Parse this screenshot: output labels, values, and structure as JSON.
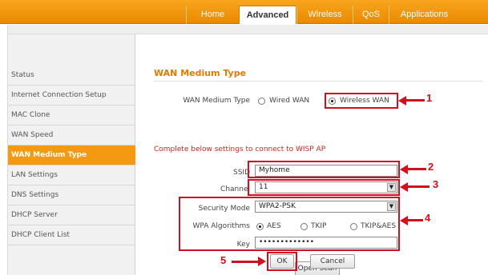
{
  "nav": {
    "tabs": [
      {
        "label": "Home"
      },
      {
        "label": "Advanced"
      },
      {
        "label": "Wireless"
      },
      {
        "label": "QoS"
      },
      {
        "label": "Applications"
      }
    ],
    "active_tab": "Advanced"
  },
  "sidebar": {
    "items": [
      {
        "label": "Status"
      },
      {
        "label": "Internet Connection Setup"
      },
      {
        "label": "MAC Clone"
      },
      {
        "label": "WAN Speed"
      },
      {
        "label": "WAN Medium Type"
      },
      {
        "label": "LAN Settings"
      },
      {
        "label": "DNS Settings"
      },
      {
        "label": "DHCP Server"
      },
      {
        "label": "DHCP Client List"
      }
    ],
    "active_item": "WAN Medium Type"
  },
  "form": {
    "title": "WAN Medium Type",
    "medium_label": "WAN Medium Type",
    "medium_options": [
      "Wired WAN",
      "Wireless WAN"
    ],
    "medium_selected": "Wireless WAN",
    "hint": "Complete below settings to connect to WISP AP",
    "ssid_label": "SSID",
    "ssid_value": "Myhome",
    "channel_label": "Channel",
    "channel_value": "11",
    "security_label": "Security Mode",
    "security_value": "WPA2-PSK",
    "algo_label": "WPA Algorithms",
    "algo_options": [
      "AES",
      "TKIP",
      "TKIP&AES"
    ],
    "algo_selected": "AES",
    "key_label": "Key",
    "key_value": "•••••••••••••",
    "open_scan": "Open Scan",
    "ok": "OK",
    "cancel": "Cancel"
  },
  "annotations": [
    "1",
    "2",
    "3",
    "4",
    "5"
  ],
  "colors": {
    "accent": "#f39a12",
    "annotation": "#d20f1f",
    "hint": "#c8281e"
  }
}
